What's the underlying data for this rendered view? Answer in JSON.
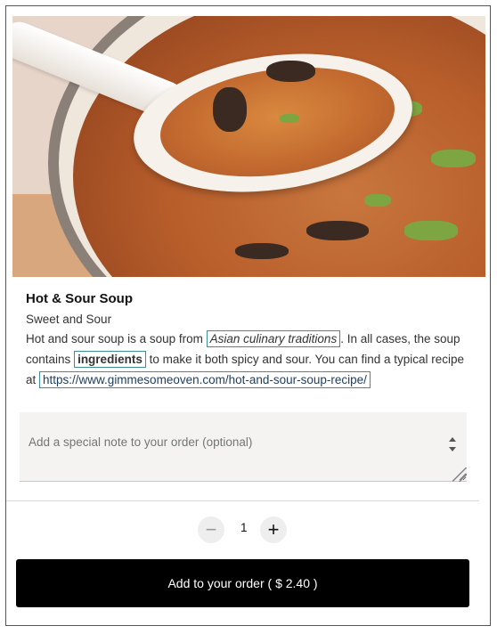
{
  "product": {
    "title": "Hot & Sour Soup",
    "subtitle": "Sweet and Sour",
    "description": {
      "part1": "Hot and sour soup is a soup from",
      "link_text": "Asian culinary traditions",
      "part2": ". In all cases, the soup contains",
      "keyword": "ingredients",
      "part3": "to make it both spicy and sour. You can find a typical recipe at",
      "url": "https://www.gimmesomeoven.com/hot-and-sour-soup-recipe/"
    }
  },
  "note": {
    "placeholder": "Add a special note to your order (optional)"
  },
  "quantity": {
    "minus_label": "−",
    "value": "1",
    "plus_label": "+"
  },
  "add_button": {
    "label": "Add to your order ( $ 2.40 )"
  },
  "colors": {
    "button_bg": "#000000",
    "highlight_border": "#3a8f9a",
    "url_text": "#1f3c5c"
  }
}
